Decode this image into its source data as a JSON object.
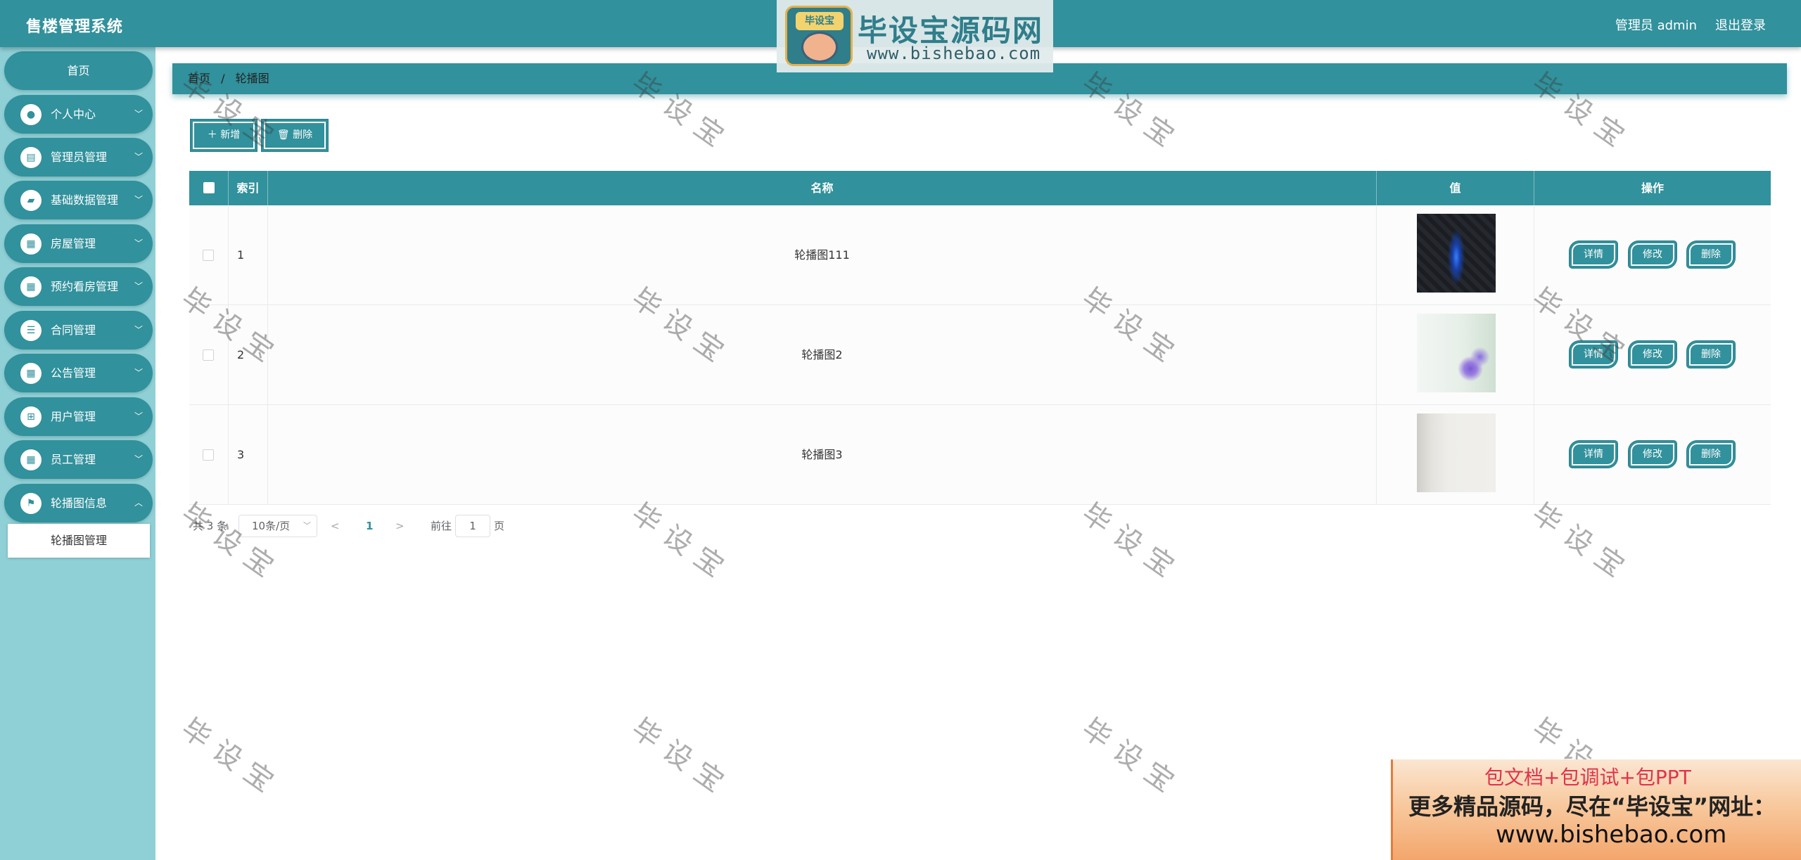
{
  "header": {
    "app_title": "售楼管理系统",
    "user_label": "管理员 admin",
    "logout_label": "退出登录"
  },
  "site_logo": {
    "badge_text": "毕设宝",
    "name": "毕设宝源码网",
    "url": "www.bishebao.com"
  },
  "sidebar": {
    "home_label": "首页",
    "items": [
      {
        "label": "个人中心",
        "icon": "user-icon"
      },
      {
        "label": "管理员管理",
        "icon": "clipboard-icon"
      },
      {
        "label": "基础数据管理",
        "icon": "thumb-icon"
      },
      {
        "label": "房屋管理",
        "icon": "grid-icon"
      },
      {
        "label": "预约看房管理",
        "icon": "grid-icon"
      },
      {
        "label": "合同管理",
        "icon": "sliders-icon"
      },
      {
        "label": "公告管理",
        "icon": "grid-icon"
      },
      {
        "label": "用户管理",
        "icon": "apps-icon"
      },
      {
        "label": "员工管理",
        "icon": "grid-icon"
      },
      {
        "label": "轮播图信息",
        "icon": "flag-icon"
      }
    ],
    "sub_item_label": "轮播图管理"
  },
  "breadcrumb": {
    "home": "首页",
    "separator": "/",
    "current": "轮播图"
  },
  "toolbar": {
    "add_label": "＋ 新增",
    "delete_label": "🗑 删除"
  },
  "table": {
    "columns": [
      "索引",
      "名称",
      "值",
      "操作"
    ],
    "rows": [
      {
        "index": "1",
        "name": "轮播图111"
      },
      {
        "index": "2",
        "name": "轮播图2"
      },
      {
        "index": "3",
        "name": "轮播图3"
      }
    ],
    "actions": {
      "detail": "详情",
      "edit": "修改",
      "delete": "删除"
    }
  },
  "pagination": {
    "total_text": "共 3 条",
    "page_size": "10条/页",
    "current_page": "1",
    "goto_label": "前往",
    "goto_value": "1",
    "page_suffix": "页"
  },
  "watermark_text": "毕设宝",
  "promo": {
    "line1": "包文档+包调试+包PPT",
    "line2": "更多精品源码，尽在“毕设宝”网址：",
    "line3": "www.bishebao.com"
  },
  "colors": {
    "primary": "#31919c",
    "sidebar_bg": "#8fd0d6"
  }
}
